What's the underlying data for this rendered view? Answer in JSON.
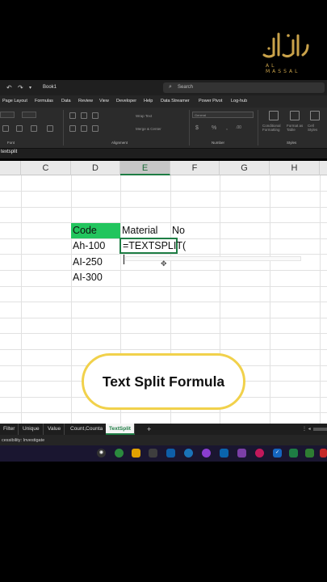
{
  "app": {
    "book_title": "Book1",
    "search_placeholder": "Search"
  },
  "menu": {
    "items": [
      "Page Layout",
      "Formulas",
      "Data",
      "Review",
      "View",
      "Developer",
      "Help",
      "Data Streamer",
      "Power Pivot",
      "Log-hub"
    ]
  },
  "ribbon": {
    "groups": [
      "Font",
      "Alignment",
      "Number",
      "Styles"
    ],
    "wrap_text": "Wrap Text",
    "merge_center": "Merge & Center",
    "number_format": "General",
    "conditional_formatting": "Conditional Formatting",
    "format_as_table": "Format as Table",
    "cell_styles": "Cell Styles"
  },
  "formula_bar": {
    "name_box": "textsplit"
  },
  "columns": [
    "C",
    "D",
    "E",
    "F",
    "G",
    "H"
  ],
  "active_column": "E",
  "cells": {
    "d_header": "Code",
    "e_header": "Material",
    "f_header": "No",
    "d_rows": [
      "Ah-100",
      "AI-250",
      "AI-300"
    ],
    "e_editing": "=TEXTSPLIT("
  },
  "overlay": {
    "caption": "Text Split Formula"
  },
  "sheet_tabs": {
    "items": [
      "Filter",
      "Unique",
      "Value",
      "Count,Counta",
      "TextSplit"
    ],
    "active": "TextSplit"
  },
  "status_bar": {
    "text": "cessibility: Investigate"
  },
  "colors": {
    "accent_green": "#1e7d44",
    "header_fill": "#22c55e",
    "caption_border": "#f1d14b",
    "logo_gold": "#c9a24a"
  }
}
